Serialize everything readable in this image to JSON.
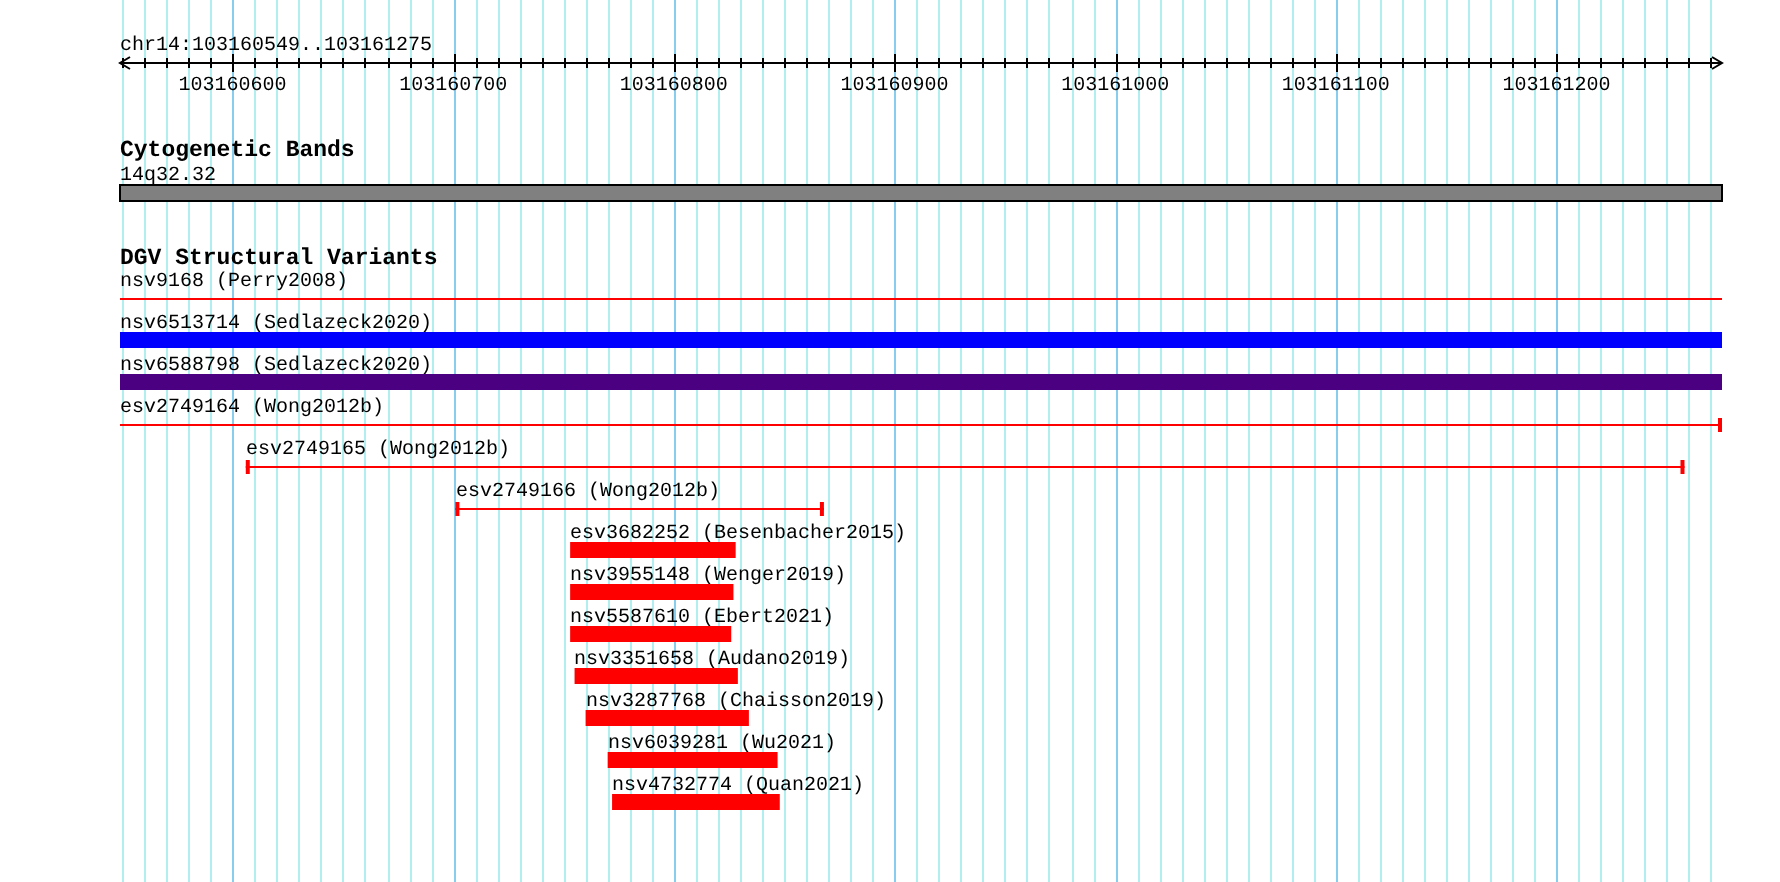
{
  "ruler": {
    "title": "chr14:103160549..103161275",
    "ticks": [
      "103160600",
      "103160700",
      "103160800",
      "103160900",
      "103161000",
      "103161100",
      "103161200"
    ]
  },
  "cytogenetic_bands": {
    "title": "Cytogenetic Bands",
    "band": "14q32.32"
  },
  "dgv_structural_variants": {
    "title": "DGV Structural Variants",
    "features": [
      {
        "label": "nsv9168 (Perry2008)",
        "kind": "line",
        "color": "#ff0000",
        "left_cap": false,
        "right_cap": false
      },
      {
        "label": "nsv6513714 (Sedlazeck2020)",
        "kind": "bar",
        "color": "#0000ff"
      },
      {
        "label": "nsv6588798 (Sedlazeck2020)",
        "kind": "bar",
        "color": "#4b0082"
      },
      {
        "label": "esv2749164 (Wong2012b)",
        "kind": "line",
        "color": "#ff0000",
        "left_cap": false,
        "right_cap": true
      },
      {
        "label": "esv2749165 (Wong2012b)",
        "kind": "line",
        "color": "#ff0000",
        "left_cap": true,
        "right_cap": true
      },
      {
        "label": "esv2749166 (Wong2012b)",
        "kind": "line",
        "color": "#ff0000",
        "left_cap": true,
        "right_cap": true
      },
      {
        "label": "esv3682252 (Besenbacher2015)",
        "kind": "bar",
        "color": "#ff0000"
      },
      {
        "label": "nsv3955148 (Wenger2019)",
        "kind": "bar",
        "color": "#ff0000"
      },
      {
        "label": "nsv5587610 (Ebert2021)",
        "kind": "bar",
        "color": "#ff0000"
      },
      {
        "label": "nsv3351658 (Audano2019)",
        "kind": "bar",
        "color": "#ff0000"
      },
      {
        "label": "nsv3287768 (Chaisson2019)",
        "kind": "bar",
        "color": "#ff0000"
      },
      {
        "label": "nsv6039281 (Wu2021)",
        "kind": "bar",
        "color": "#ff0000"
      },
      {
        "label": "nsv4732774 (Quan2021)",
        "kind": "bar",
        "color": "#ff0000"
      }
    ]
  }
}
